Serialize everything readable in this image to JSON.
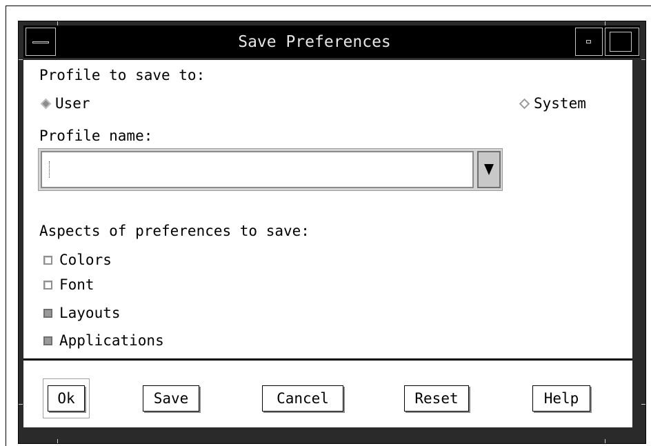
{
  "window": {
    "title": "Save Preferences"
  },
  "profile_section": {
    "label": "Profile to save to:",
    "options": [
      {
        "label": "User",
        "selected": true
      },
      {
        "label": "System",
        "selected": false
      }
    ]
  },
  "profile_name": {
    "label": "Profile name:",
    "value": ""
  },
  "aspects": {
    "label": "Aspects of preferences to save:",
    "items": [
      {
        "label": "Colors",
        "checked": false
      },
      {
        "label": "Font",
        "checked": false
      },
      {
        "label": "Layouts",
        "checked": true
      },
      {
        "label": "Applications",
        "checked": true
      }
    ]
  },
  "buttons": {
    "ok": "Ok",
    "save": "Save",
    "cancel": "Cancel",
    "reset": "Reset",
    "help": "Help"
  }
}
